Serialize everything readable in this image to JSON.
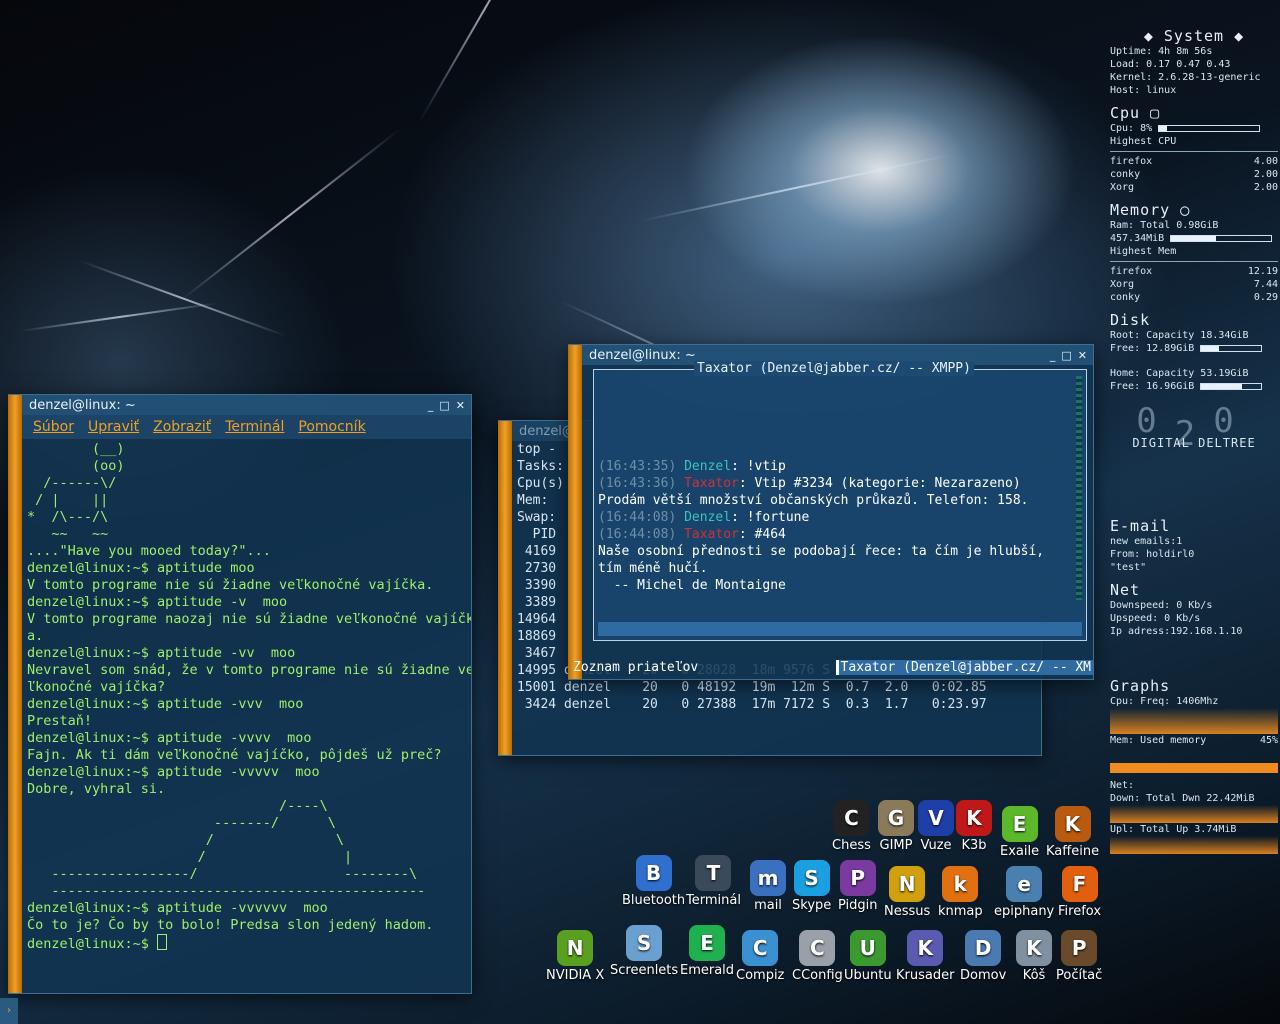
{
  "terminal1": {
    "title": "denzel@linux: ~",
    "menu": [
      "Súbor",
      "Upraviť",
      "Zobraziť",
      "Terminál",
      "Pomocník"
    ],
    "lines": [
      "        (__)",
      "        (oo)",
      "  /------\\/",
      " / |    ||",
      "*  /\\---/\\",
      "   ~~   ~~",
      "....\"Have you mooed today?\"...",
      "denzel@linux:~$ aptitude moo",
      "V tomto programe nie sú žiadne veľkonočné vajíčka.",
      "denzel@linux:~$ aptitude -v  moo",
      "V tomto programe naozaj nie sú žiadne veľkonočné vajíčk",
      "a.",
      "denzel@linux:~$ aptitude -vv  moo",
      "Nevravel som snád, že v tomto programe nie sú žiadne ve",
      "ľkonočné vajíčka?",
      "denzel@linux:~$ aptitude -vvv  moo",
      "Prestaň!",
      "denzel@linux:~$ aptitude -vvvv  moo",
      "Fajn. Ak ti dám veľkonočné vajíčko, pôjdeš už preč?",
      "denzel@linux:~$ aptitude -vvvvv  moo",
      "Dobre, vyhral si.",
      "",
      "",
      "                               /----\\",
      "                       -------/      \\",
      "                      /               \\",
      "                     /                 |",
      "   -----------------/                  --------\\",
      "   ----------------------------------------------",
      "denzel@linux:~$ aptitude -vvvvvv  moo",
      "Čo to je? Čo by to bolo! Predsa slon jedený hadom."
    ],
    "prompt": "denzel@linux:~$ "
  },
  "terminal2": {
    "title": "denzel@",
    "lines": [
      "top -",
      "Tasks:",
      "Cpu(s)",
      "Mem:",
      "Swap:",
      "",
      "  PID",
      " 4169",
      " 2730",
      " 3390",
      " 3389",
      "14964",
      "18869",
      " 3467",
      "14995 denzel    20   0 28028  18m 9576 S  0.7  1.5   0:06.67",
      "15001 denzel    20   0 48192  19m  12m S  0.7  2.0   0:02.85",
      " 3424 denzel    20   0 27388  17m 7172 S  0.3  1.7   0:23.97"
    ]
  },
  "chat": {
    "title": "denzel@linux: ~",
    "box_title": "Taxator (Denzel@jabber.cz/ -- XMPP)",
    "messages": [
      {
        "ts": "(16:43:35)",
        "nick": "Denzel",
        "kind": "d",
        "text": ": !vtip"
      },
      {
        "ts": "(16:43:36)",
        "nick": "Taxator",
        "kind": "t",
        "text": ": Vtip #3234 (kategorie: Nezarazeno)"
      },
      {
        "ts": "",
        "nick": "",
        "kind": "",
        "text": "Prodám větší množství občanských průkazů. Telefon: 158."
      },
      {
        "ts": "(16:44:08)",
        "nick": "Denzel",
        "kind": "d",
        "text": ": !fortune"
      },
      {
        "ts": "(16:44:08)",
        "nick": "Taxator",
        "kind": "t",
        "text": ": #464"
      },
      {
        "ts": "",
        "nick": "",
        "kind": "",
        "text": "Naše osobní přednosti se podobají řece: ta čím je hlubší,"
      },
      {
        "ts": "",
        "nick": "",
        "kind": "",
        "text": "tím méně hučí."
      },
      {
        "ts": "",
        "nick": "",
        "kind": "",
        "text": "  -- Michel de Montaigne"
      }
    ],
    "status_left": "Zoznam priateľov",
    "status_right": "Taxator (Denzel@jabber.cz/ -- XM"
  },
  "conky": {
    "system_title": "System",
    "uptime": "Uptime: 4h 8m 56s",
    "load": "Load: 0.17 0.47 0.43",
    "kernel": "Kernel: 2.6.28-13-generic",
    "host": "Host: linux",
    "cpu_title": "Cpu",
    "cpu_line": "Cpu: 8%",
    "cpu_pct": 0.08,
    "highest_cpu": "Highest CPU",
    "cpu_top": [
      [
        "firefox",
        "4.00"
      ],
      [
        "conky",
        "2.00"
      ],
      [
        "Xorg",
        "2.00"
      ]
    ],
    "mem_title": "Memory",
    "ram_total": "Ram: Total 0.98GiB",
    "ram_used": "457.34MiB",
    "ram_pct": 0.45,
    "highest_mem": "Highest Mem",
    "mem_top": [
      [
        "firefox",
        "12.19"
      ],
      [
        "Xorg",
        "7.44"
      ],
      [
        "conky",
        "0.29"
      ]
    ],
    "disk_title": "Disk",
    "root_cap": "Root: Capacity 18.34GiB",
    "root_free": "Free: 12.89GiB",
    "root_pct": 0.3,
    "home_cap": "Home: Capacity 53.19GiB",
    "home_free": "Free: 16.96GiB",
    "home_pct": 0.68,
    "logo_text": "DIGITAL DELTREE",
    "logo_digits": "0 0 2",
    "email_title": "E-mail",
    "email_new": "new emails:1",
    "email_from": "From: holdirl0",
    "email_subj": "\"test\"",
    "net_title": "Net",
    "downspeed": "Downspeed: 0 Kb/s",
    "upspeed": "Upspeed: 0 Kb/s",
    "ip": "Ip adress:192.168.1.10",
    "graphs_title": "Graphs",
    "cpu_freq": "Cpu: Freq: 1406Mhz",
    "mem_used": "Mem: Used memory",
    "mem_used_pct": "45%",
    "net_label": "Net:",
    "down_total": "Down: Total Dwn 22.42MiB",
    "up_total": "Upl: Total Up 3.74MiB"
  },
  "desktop_icons": [
    {
      "label": "Chess",
      "icon": "chess-icon",
      "color": "#222"
    },
    {
      "label": "GIMP",
      "icon": "gimp-icon",
      "color": "#8a7a5a"
    },
    {
      "label": "Vuze",
      "icon": "vuze-icon",
      "color": "#1f3fa8"
    },
    {
      "label": "K3b",
      "icon": "k3b-icon",
      "color": "#c01818"
    },
    {
      "label": "Exaile",
      "icon": "exaile-icon",
      "color": "#5cb82a"
    },
    {
      "label": "Kaffeine",
      "icon": "kaffeine-icon",
      "color": "#b85a10"
    },
    {
      "label": "Bluetooth",
      "icon": "bluetooth-icon",
      "color": "#2f6fd0"
    },
    {
      "label": "Terminál",
      "icon": "terminal-icon",
      "color": "#3a4a5a"
    },
    {
      "label": "mail",
      "icon": "mail-icon",
      "color": "#3a70c0"
    },
    {
      "label": "Skype",
      "icon": "skype-icon",
      "color": "#1aa0e0"
    },
    {
      "label": "Pidgin",
      "icon": "pidgin-icon",
      "color": "#7a3aa0"
    },
    {
      "label": "Nessus",
      "icon": "nessus-icon",
      "color": "#d0a010"
    },
    {
      "label": "knmap",
      "icon": "knmap-icon",
      "color": "#e07010"
    },
    {
      "label": "epiphany",
      "icon": "epiphany-icon",
      "color": "#4a80b0"
    },
    {
      "label": "Firefox",
      "icon": "firefox-icon",
      "color": "#e06010"
    },
    {
      "label": "NVIDIA X",
      "icon": "nvidia-icon",
      "color": "#5aa020"
    },
    {
      "label": "Screenlets",
      "icon": "screenlets-icon",
      "color": "#6aa0d0"
    },
    {
      "label": "Emerald",
      "icon": "emerald-icon",
      "color": "#20b050"
    },
    {
      "label": "Compiz",
      "icon": "compiz-icon",
      "color": "#3a90d0"
    },
    {
      "label": "CConfig",
      "icon": "cconfig-icon",
      "color": "#9aa0a8"
    },
    {
      "label": "Ubuntu",
      "icon": "ubuntu-icon",
      "color": "#3a9a30"
    },
    {
      "label": "Krusader",
      "icon": "krusader-icon",
      "color": "#5a5ab0"
    },
    {
      "label": "Domov",
      "icon": "home-folder-icon",
      "color": "#4a7ab0"
    },
    {
      "label": "Kôš",
      "icon": "trash-icon",
      "color": "#8090a0"
    },
    {
      "label": "Počítač",
      "icon": "computer-icon",
      "color": "#6a4a2a"
    }
  ]
}
